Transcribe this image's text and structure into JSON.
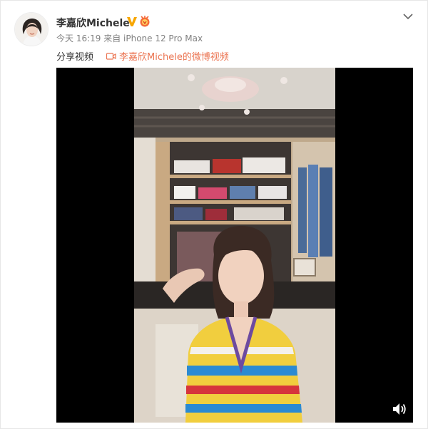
{
  "post": {
    "author": "李嘉欣Michele",
    "meta": "今天 16:19 来自 iPhone 12 Pro Max",
    "text": "分享视频",
    "video_link": "李嘉欣Michele的微博视频"
  },
  "icons": {
    "verified": "verified-v-icon",
    "medal": "member-medal-icon",
    "menu": "chevron-down-icon",
    "video": "video-camera-icon",
    "volume": "volume-icon"
  },
  "colors": {
    "link": "#eb7350",
    "verified": "#f7a600",
    "player_bg": "#000000"
  }
}
